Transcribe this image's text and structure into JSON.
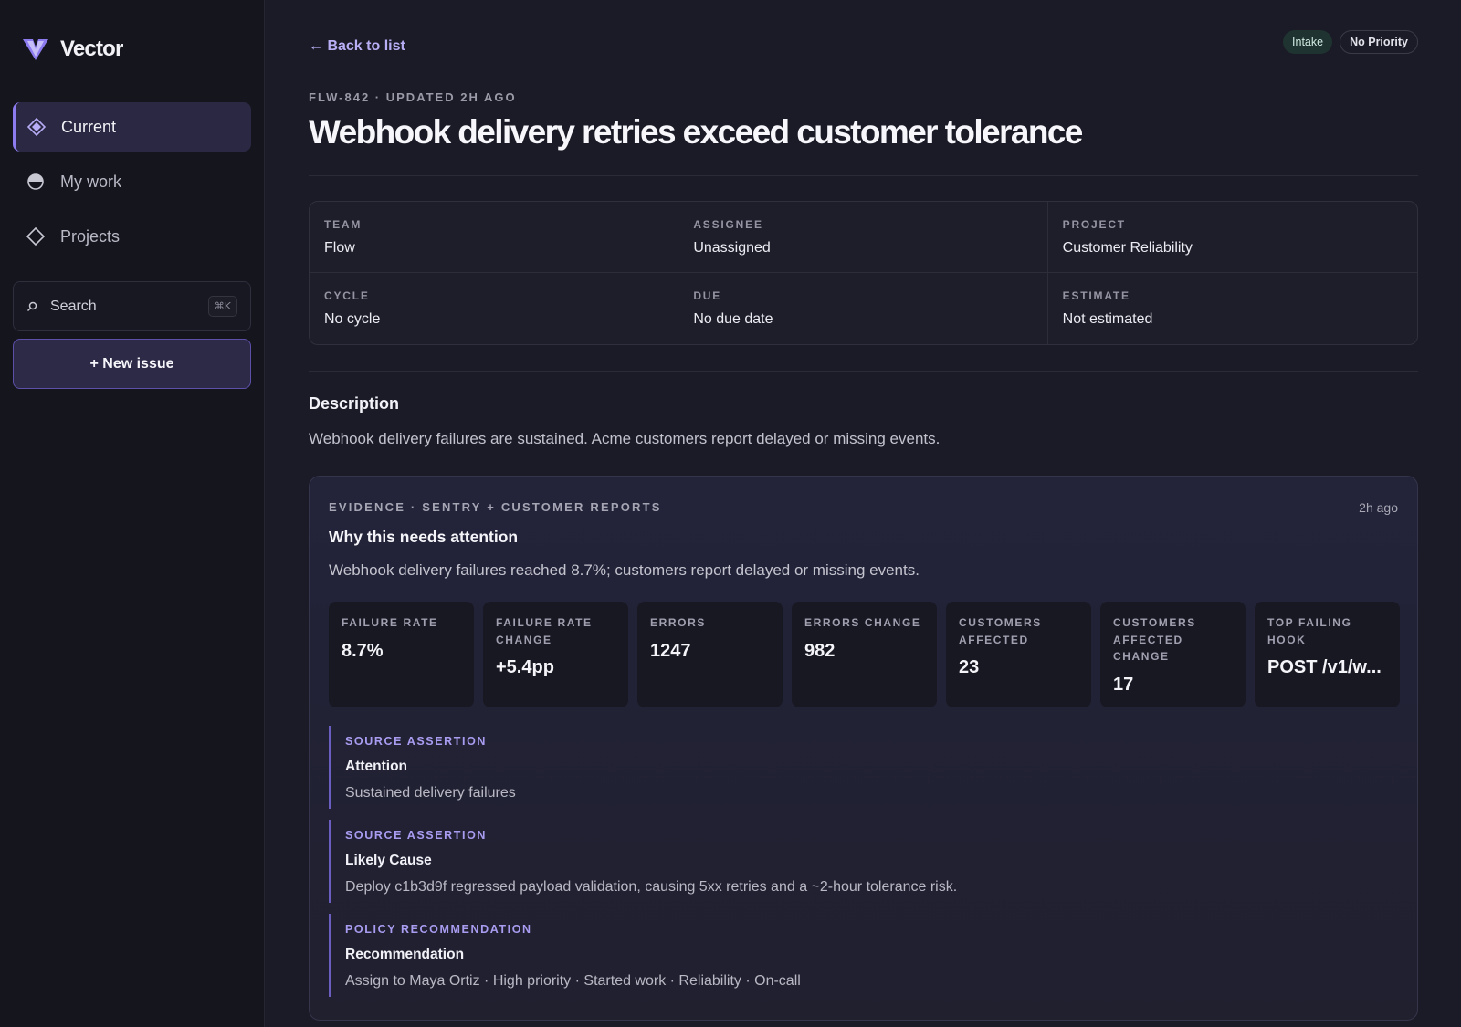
{
  "brand": {
    "name": "Vector"
  },
  "sidebar": {
    "items": [
      {
        "label": "Current",
        "icon": "diamond-fill-icon",
        "active": true
      },
      {
        "label": "My work",
        "icon": "half-circle-icon",
        "active": false
      },
      {
        "label": "Projects",
        "icon": "diamond-outline-icon",
        "active": false
      }
    ],
    "search": {
      "label": "Search",
      "shortcut": "⌘K"
    },
    "new_issue_label": "+ New issue"
  },
  "header": {
    "back_label": "← Back to list",
    "badges": {
      "status": "Intake",
      "priority": "No Priority"
    },
    "meta": "FLW-842 · UPDATED 2H AGO",
    "title": "Webhook delivery retries exceed customer tolerance"
  },
  "properties": [
    {
      "label": "TEAM",
      "value": "Flow"
    },
    {
      "label": "ASSIGNEE",
      "value": "Unassigned"
    },
    {
      "label": "PROJECT",
      "value": "Customer Reliability"
    },
    {
      "label": "CYCLE",
      "value": "No cycle"
    },
    {
      "label": "DUE",
      "value": "No due date"
    },
    {
      "label": "ESTIMATE",
      "value": "Not estimated"
    }
  ],
  "description": {
    "heading": "Description",
    "text": "Webhook delivery failures are sustained. Acme customers report delayed or missing events."
  },
  "evidence": {
    "header": "EVIDENCE · SENTRY + CUSTOMER REPORTS",
    "time": "2h ago",
    "title": "Why this needs attention",
    "summary": "Webhook delivery failures reached 8.7%; customers report delayed or missing events.",
    "metrics": [
      {
        "label": "FAILURE RATE",
        "value": "8.7%"
      },
      {
        "label": "FAILURE RATE CHANGE",
        "value": "+5.4pp"
      },
      {
        "label": "ERRORS",
        "value": "1247"
      },
      {
        "label": "ERRORS CHANGE",
        "value": "982"
      },
      {
        "label": "CUSTOMERS AFFECTED",
        "value": "23"
      },
      {
        "label": "CUSTOMERS AFFECTED CHANGE",
        "value": "17"
      },
      {
        "label": "TOP FAILING HOOK",
        "value": "POST /v1/w..."
      }
    ],
    "assertions": [
      {
        "kind": "SOURCE ASSERTION",
        "title": "Attention",
        "text": "Sustained delivery failures"
      },
      {
        "kind": "SOURCE ASSERTION",
        "title": "Likely Cause",
        "text": "Deploy c1b3d9f regressed payload validation, causing 5xx retries and a ~2-hour tolerance risk."
      },
      {
        "kind": "POLICY RECOMMENDATION",
        "title": "Recommendation",
        "text": "Assign to Maya Ortiz · High priority · Started work · Reliability · On-call"
      }
    ]
  },
  "colors": {
    "accent": "#8c7cf0",
    "background": "#1b1b27",
    "sidebar": "#15151e"
  }
}
